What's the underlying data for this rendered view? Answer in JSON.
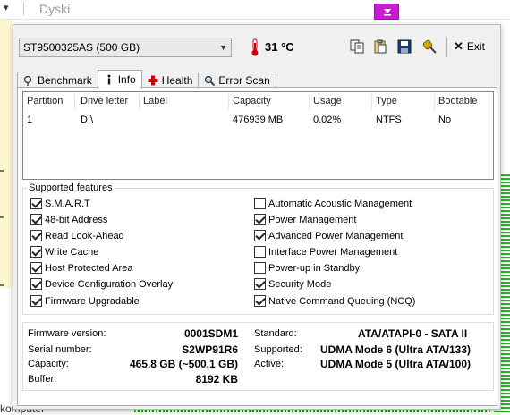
{
  "background": {
    "title": "Dyski",
    "bottom_text": "komputer"
  },
  "toolbar": {
    "drive": "ST9500325AS (500 GB)",
    "temperature": "31 °C",
    "exit_label": "Exit"
  },
  "tabs": [
    {
      "label": "Benchmark",
      "icon": "benchmark-icon"
    },
    {
      "label": "Info",
      "icon": "info-icon",
      "active": true
    },
    {
      "label": "Health",
      "icon": "health-cross-icon"
    },
    {
      "label": "Error Scan",
      "icon": "magnifier-icon"
    }
  ],
  "partition_table": {
    "headers": [
      "Partition",
      "Drive letter",
      "Label",
      "Capacity",
      "Usage",
      "Type",
      "Bootable"
    ],
    "rows": [
      [
        "1",
        "D:\\",
        "",
        "476939 MB",
        "0.02%",
        "NTFS",
        "No"
      ]
    ]
  },
  "features": {
    "title": "Supported features",
    "left": [
      {
        "label": "S.M.A.R.T",
        "checked": true
      },
      {
        "label": "48-bit Address",
        "checked": true
      },
      {
        "label": "Read Look-Ahead",
        "checked": true
      },
      {
        "label": "Write Cache",
        "checked": true
      },
      {
        "label": "Host Protected Area",
        "checked": true
      },
      {
        "label": "Device Configuration Overlay",
        "checked": true
      },
      {
        "label": "Firmware Upgradable",
        "checked": true
      }
    ],
    "right": [
      {
        "label": "Automatic Acoustic Management",
        "checked": false
      },
      {
        "label": "Power Management",
        "checked": true
      },
      {
        "label": "Advanced Power Management",
        "checked": true
      },
      {
        "label": "Interface Power Management",
        "checked": false
      },
      {
        "label": "Power-up in Standby",
        "checked": false
      },
      {
        "label": "Security Mode",
        "checked": true
      },
      {
        "label": "Native Command Queuing (NCQ)",
        "checked": true
      }
    ]
  },
  "info": {
    "firmware_label": "Firmware version:",
    "firmware": "0001SDM1",
    "serial_label": "Serial number:",
    "serial": "S2WP91R6",
    "capacity_label": "Capacity:",
    "capacity": "465.8 GB (~500.1 GB)",
    "buffer_label": "Buffer:",
    "buffer": "8192 KB",
    "standard_label": "Standard:",
    "standard": "ATA/ATAPI-0 - SATA II",
    "supported_label": "Supported:",
    "supported": "UDMA Mode 6 (Ultra ATA/133)",
    "active_label": "Active:",
    "active": "UDMA Mode 5 (Ultra ATA/100)"
  }
}
